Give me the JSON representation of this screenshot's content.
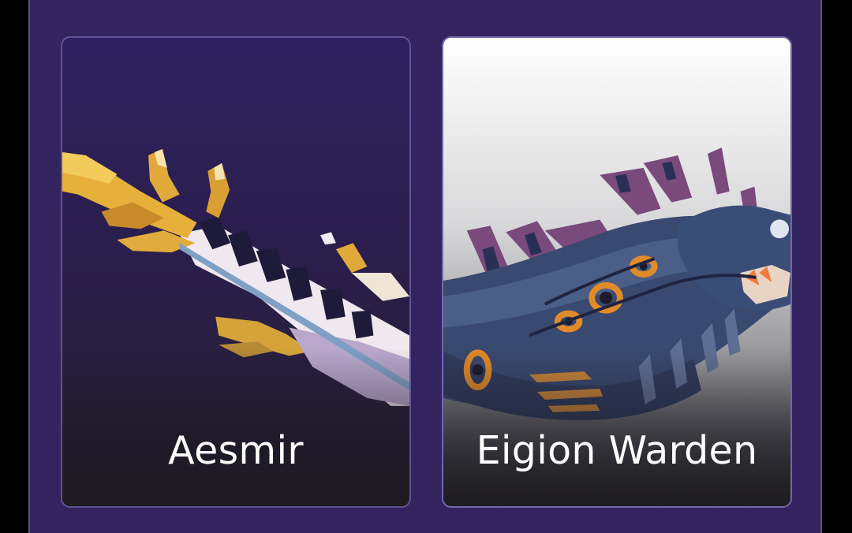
{
  "creatures": [
    {
      "name": "Aesmir",
      "art": "dragon-aesmir-image"
    },
    {
      "name": "Eigion Warden",
      "art": "dragon-eigion-warden-image"
    }
  ],
  "colors": {
    "panel_bg": "#33245f",
    "card_border": "#5e5396",
    "label_text": "#ffffff"
  }
}
